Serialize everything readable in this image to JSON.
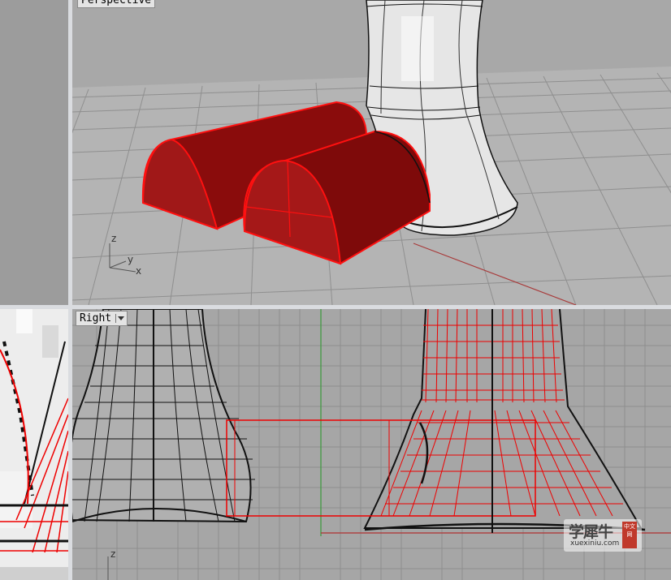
{
  "viewports": {
    "perspective": {
      "title": "Perspective"
    },
    "right": {
      "title": "Right"
    }
  },
  "axes": {
    "z": "z",
    "y": "y",
    "x": "x"
  },
  "watermark": {
    "brand": "学犀牛",
    "site": "xuexiniu.com",
    "badge": "中文网"
  },
  "colors": {
    "selected": "#e00000",
    "surface_red": "#9a1010",
    "grid": "#8e8e8e",
    "x_axis": "#b03030",
    "y_axis": "#3a9a3a"
  }
}
